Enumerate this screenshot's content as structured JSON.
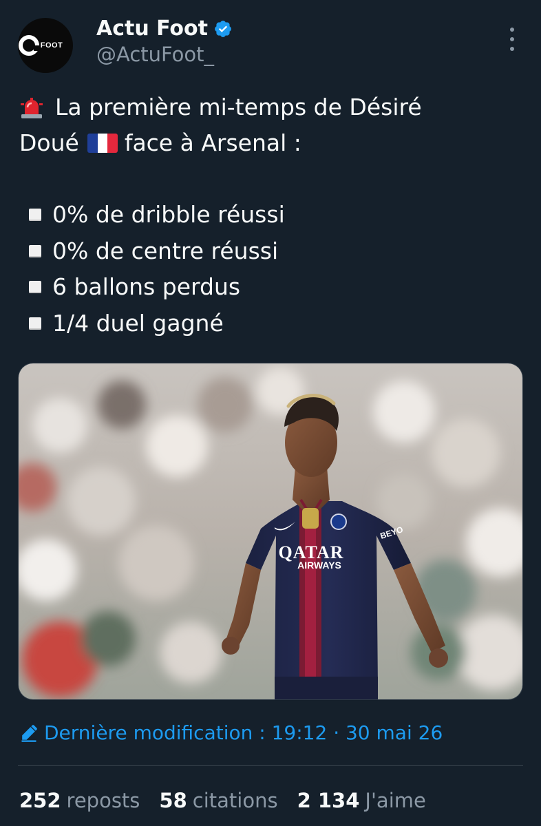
{
  "author": {
    "display_name": "Actu Foot",
    "handle": "@ActuFoot_",
    "avatar_text": "FOOT",
    "verified": true
  },
  "tweet": {
    "line1": "La première mi-temps de Désiré",
    "line2_a": "Doué",
    "line2_b": "face à Arsenal :",
    "bullets": [
      "0% de dribble réussi",
      "0% de centre réussi",
      "6 ballons perdus",
      "1/4 duel gagné"
    ],
    "icons": {
      "lead": "police-car-light-icon",
      "flag": "france-flag-icon",
      "bullet": "white-square-icon"
    }
  },
  "photo": {
    "description_icon": "player-photo",
    "sponsor_line1": "QATAR",
    "sponsor_line2": "AIRWAYS",
    "sleeve_text": "BEYO"
  },
  "edit": {
    "label": "Dernière modification : 19:12 · 30 mai 26"
  },
  "stats": [
    {
      "num": "252",
      "label": "reposts"
    },
    {
      "num": "58",
      "label": "citations"
    },
    {
      "num": "2 134",
      "label": "J'aime"
    }
  ],
  "colors": {
    "background": "#15202b",
    "accent": "#1d9bf0",
    "muted": "#8b98a5",
    "text": "#f7f9f9"
  }
}
